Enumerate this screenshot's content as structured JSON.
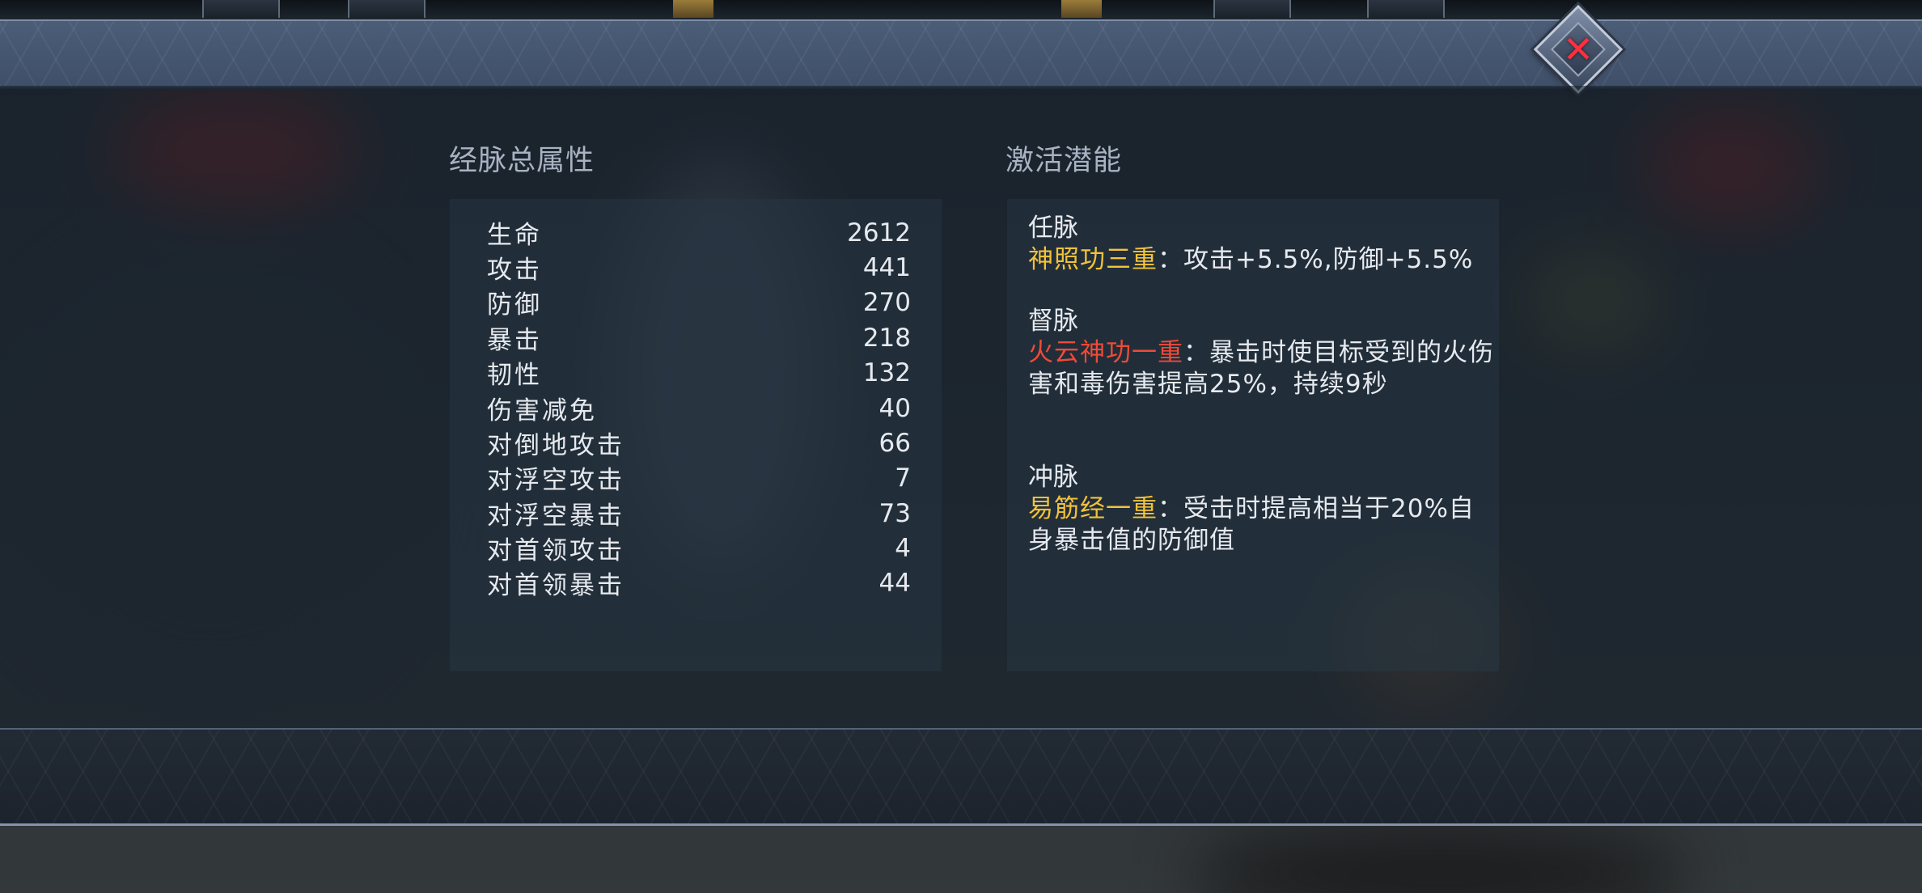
{
  "close_icon": "close-x-icon",
  "colors": {
    "gold": "#f2c23a",
    "red": "#f04a38",
    "text": "#e6e9ee",
    "title": "#a8b2c2"
  },
  "left_section": {
    "title": "经脉总属性",
    "stats": [
      {
        "name": "生命",
        "value": "2612"
      },
      {
        "name": "攻击",
        "value": "441"
      },
      {
        "name": "防御",
        "value": "270"
      },
      {
        "name": "暴击",
        "value": "218"
      },
      {
        "name": "韧性",
        "value": "132"
      },
      {
        "name": "伤害减免",
        "value": "40"
      },
      {
        "name": "对倒地攻击",
        "value": "66"
      },
      {
        "name": "对浮空攻击",
        "value": "7"
      },
      {
        "name": "对浮空暴击",
        "value": "73"
      },
      {
        "name": "对首领攻击",
        "value": "4"
      },
      {
        "name": "对首领暴击",
        "value": "44"
      }
    ]
  },
  "right_section": {
    "title": "激活潜能",
    "meridians": [
      {
        "name": "任脉",
        "skill": "神照功三重",
        "desc": "：攻击+5.5%,防御+5.5%"
      },
      {
        "name": "督脉",
        "skill": "火云神功一重",
        "desc": "：暴击时使目标受到的火伤害和毒伤害提高25%，持续9秒"
      },
      {
        "name": "冲脉",
        "skill": "易筋经一重",
        "desc": "：受击时提高相当于20%自身暴击值的防御值"
      }
    ]
  }
}
